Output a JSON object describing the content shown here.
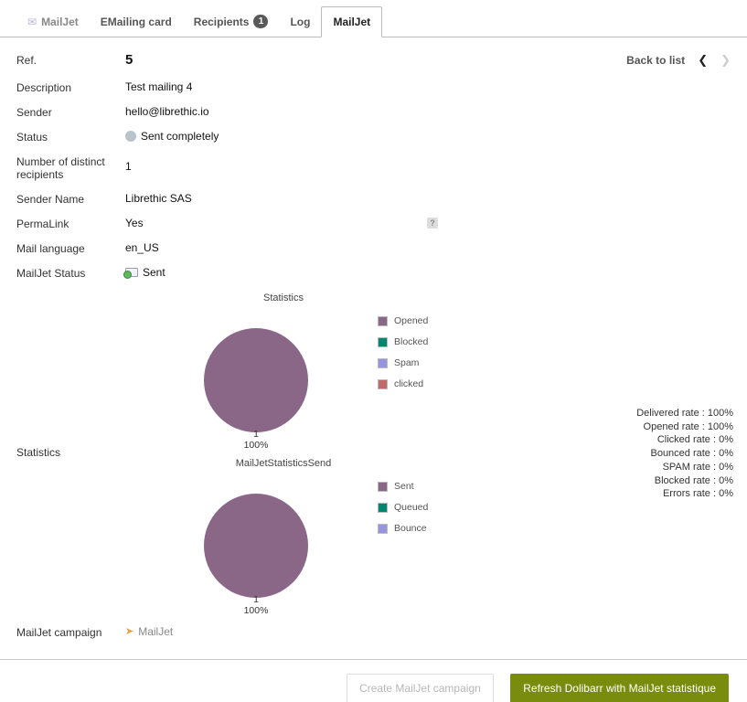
{
  "tabs": [
    {
      "label": "MailJet",
      "icon": "email-object-icon",
      "icon_symbol": "✉",
      "style": "muted"
    },
    {
      "label": "EMailing card"
    },
    {
      "label": "Recipients",
      "badge": "1"
    },
    {
      "label": "Log"
    },
    {
      "label": "MailJet",
      "style": "active"
    }
  ],
  "nav": {
    "back_label": "Back to list",
    "prev_symbol": "❮",
    "next_symbol": "❯"
  },
  "fields": {
    "ref": {
      "label": "Ref.",
      "value": "5"
    },
    "description": {
      "label": "Description",
      "value": "Test mailing 4"
    },
    "sender": {
      "label": "Sender",
      "value": "hello@librethic.io"
    },
    "status": {
      "label": "Status",
      "value": "Sent completely"
    },
    "recipients": {
      "label": "Number of distinct recipients",
      "value": "1"
    },
    "sender_name": {
      "label": "Sender Name",
      "value": "Librethic SAS"
    },
    "permalink": {
      "label": "PermaLink",
      "value": "Yes",
      "help_symbol": "?"
    },
    "mail_language": {
      "label": "Mail language",
      "value": "en_US"
    },
    "mailjet_status": {
      "label": "MailJet Status",
      "value": "Sent"
    },
    "statistics": {
      "label": "Statistics"
    },
    "campaign": {
      "label": "MailJet campaign",
      "value": "MailJet",
      "icon_symbol": "➤"
    }
  },
  "chart_data": [
    {
      "type": "pie",
      "title": "Statistics",
      "count_label": "1",
      "pct_label": "100%",
      "slices": [
        {
          "label": "Opened",
          "value": 1,
          "pct": 100,
          "color": "#8a6786"
        },
        {
          "label": "Blocked",
          "value": 0,
          "pct": 0,
          "color": "#00876f"
        },
        {
          "label": "Spam",
          "value": 0,
          "pct": 0,
          "color": "#9595e2"
        },
        {
          "label": "clicked",
          "value": 0,
          "pct": 0,
          "color": "#c16a6a"
        }
      ]
    },
    {
      "type": "pie",
      "title": "MailJetStatisticsSend",
      "count_label": "1",
      "pct_label": "100%",
      "slices": [
        {
          "label": "Sent",
          "value": 1,
          "pct": 100,
          "color": "#8a6786"
        },
        {
          "label": "Queued",
          "value": 0,
          "pct": 0,
          "color": "#00876f"
        },
        {
          "label": "Bounce",
          "value": 0,
          "pct": 0,
          "color": "#9595e2"
        }
      ]
    }
  ],
  "rates": [
    "Delivered rate : 100%",
    "Opened rate : 100%",
    "Clicked rate : 0%",
    "Bounced rate : 0%",
    "SPAM rate : 0%",
    "Blocked rate : 0%",
    "Errors rate : 0%"
  ],
  "buttons": {
    "create": "Create MailJet campaign",
    "refresh": "Refresh Dolibarr with MailJet statistique"
  },
  "colors": {
    "accent_purple": "#9b6394",
    "pie_purple": "#8a6786",
    "button_green": "#798c0e",
    "status_dot": "#b7c4cb",
    "plane_orange": "#e9a13b"
  }
}
